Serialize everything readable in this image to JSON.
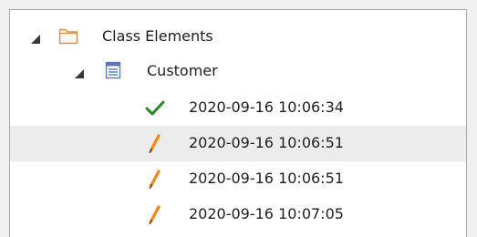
{
  "tree": {
    "class_elements": {
      "label": "Class Elements",
      "icon": "folder-icon",
      "expanded": true
    },
    "customer": {
      "label": "Customer",
      "icon": "class-element-icon",
      "expanded": true
    },
    "versions": [
      {
        "timestamp": "2020-09-16 10:06:34",
        "icon": "checkmark-icon",
        "status_color": "#2a8a2a"
      },
      {
        "timestamp": "2020-09-16 10:06:51",
        "icon": "pencil-icon",
        "status_color": "#f08c1c",
        "selected": true
      },
      {
        "timestamp": "2020-09-16 10:06:51",
        "icon": "pencil-icon",
        "status_color": "#f08c1c"
      },
      {
        "timestamp": "2020-09-16 10:07:05",
        "icon": "pencil-icon",
        "status_color": "#f08c1c"
      }
    ]
  },
  "colors": {
    "folder": "#c9925a",
    "class_icon": "#5a78b4",
    "selection_background": "#ececec"
  }
}
